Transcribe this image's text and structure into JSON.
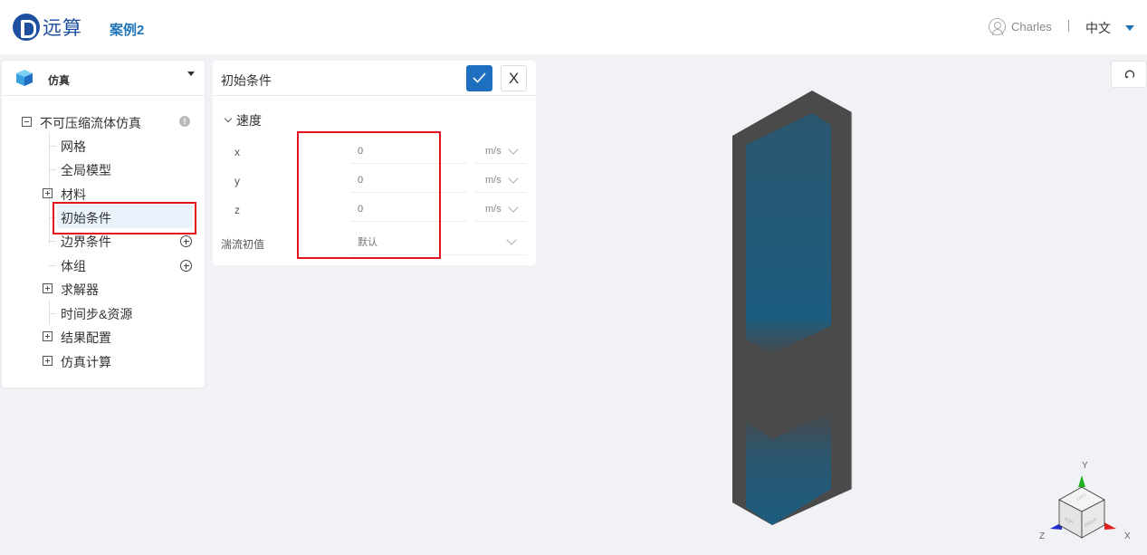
{
  "header": {
    "logo_text": "远算",
    "project_name": "案例2",
    "user_name": "Charles",
    "language": "中文"
  },
  "left_panel": {
    "title": "仿真",
    "tree": {
      "root": "不可压缩流体仿真",
      "items": [
        {
          "label": "网格",
          "type": "leaf"
        },
        {
          "label": "全局模型",
          "type": "leaf"
        },
        {
          "label": "材料",
          "type": "expandable"
        },
        {
          "label": "初始条件",
          "type": "leaf",
          "selected": true
        },
        {
          "label": "边界条件",
          "type": "leaf",
          "action": "add"
        },
        {
          "label": "体组",
          "type": "leaf",
          "action": "add"
        },
        {
          "label": "求解器",
          "type": "expandable"
        },
        {
          "label": "时间步&资源",
          "type": "leaf"
        },
        {
          "label": "结果配置",
          "type": "expandable"
        },
        {
          "label": "仿真计算",
          "type": "expandable"
        }
      ]
    }
  },
  "initial_conditions": {
    "title": "初始条件",
    "confirm_icon": "check-icon",
    "close_label": "X",
    "section": "速度",
    "velocity": [
      {
        "axis": "x",
        "value": "0",
        "unit": "m/s"
      },
      {
        "axis": "y",
        "value": "0",
        "unit": "m/s"
      },
      {
        "axis": "z",
        "value": "0",
        "unit": "m/s"
      }
    ],
    "turbulence": {
      "label": "湍流初值",
      "value": "默认"
    }
  },
  "viewer": {
    "axis_labels": {
      "x": "X",
      "y": "Y",
      "z": "Z"
    },
    "cube_faces": {
      "left": "LEFT",
      "top": "TOP",
      "right": "RIGHT"
    },
    "colors": {
      "body": "#4a4a4a",
      "mesh": "#1a5f85",
      "x_axis": "#e02020",
      "y_axis": "#20b020",
      "z_axis": "#2030d0"
    }
  }
}
